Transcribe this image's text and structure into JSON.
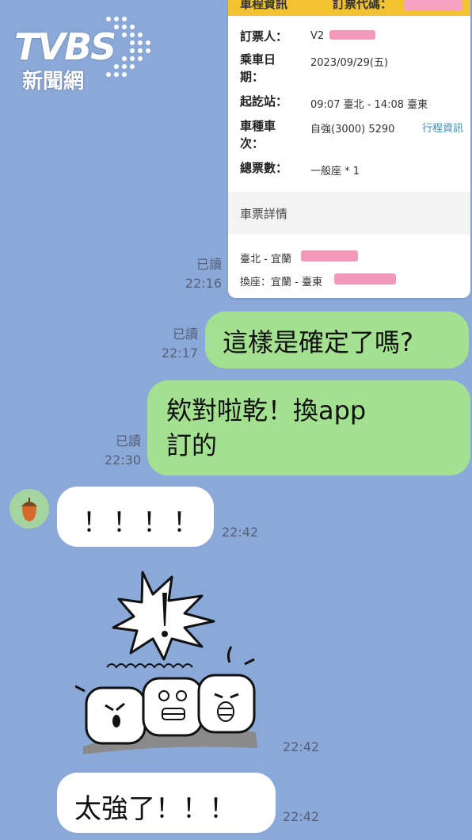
{
  "watermark": {
    "brand": "TVBS",
    "subtitle": "新聞網"
  },
  "ticket": {
    "header_left": "車程資訊",
    "header_right": "訂票代碼：",
    "rows": [
      {
        "label": "訂票人：",
        "value": "V2"
      },
      {
        "label": "乘車日期：",
        "value": "2023/09/29(五)"
      },
      {
        "label": "起訖站：",
        "value": "09:07 臺北 - 14:08 臺東"
      },
      {
        "label": "車種車次：",
        "value": "自強(3000) 5290",
        "link": "行程資訊"
      },
      {
        "label": "總票數：",
        "value": "一般座 * 1"
      }
    ],
    "section_title": "車票詳情",
    "details": [
      "臺北 - 宜蘭",
      "換座：宜蘭 - 臺東"
    ]
  },
  "messages": [
    {
      "read": "已讀",
      "time": "22:16"
    },
    {
      "read": "已讀",
      "time": "22:17",
      "text": "這樣是確定了嗎?"
    },
    {
      "read": "已讀",
      "time": "22:30",
      "line1": "欸對啦乾！換app",
      "line2": "訂的"
    },
    {
      "time": "22:42",
      "text": "！！！！"
    },
    {
      "time": "22:42",
      "sticker": "shocked-tofu-sticker"
    },
    {
      "time": "22:42",
      "text": "太強了！！！"
    }
  ],
  "colors": {
    "background": "#8ba9d8",
    "sent_bubble": "#a3e08f",
    "received_bubble": "#ffffff",
    "ticket_bar": "#f2c230",
    "redaction": "#f39abb"
  }
}
